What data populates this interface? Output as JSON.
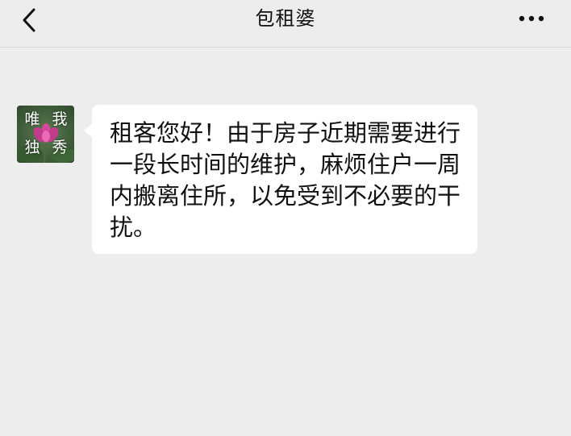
{
  "header": {
    "title": "包租婆",
    "back_icon": "chevron-left-icon",
    "more_icon": "more-dots-icon"
  },
  "contact": {
    "avatar_chars": [
      "唯",
      "我",
      "独",
      "秀"
    ],
    "avatar_image": "lotus-flower"
  },
  "messages": [
    {
      "from": "contact",
      "text": "租客您好！由于房子近期需要进行一段长时间的维护，麻烦住户一周内搬离住所，以免受到不必要的干扰。"
    }
  ],
  "colors": {
    "background": "#ededed",
    "bubble": "#ffffff",
    "text": "#111111"
  }
}
